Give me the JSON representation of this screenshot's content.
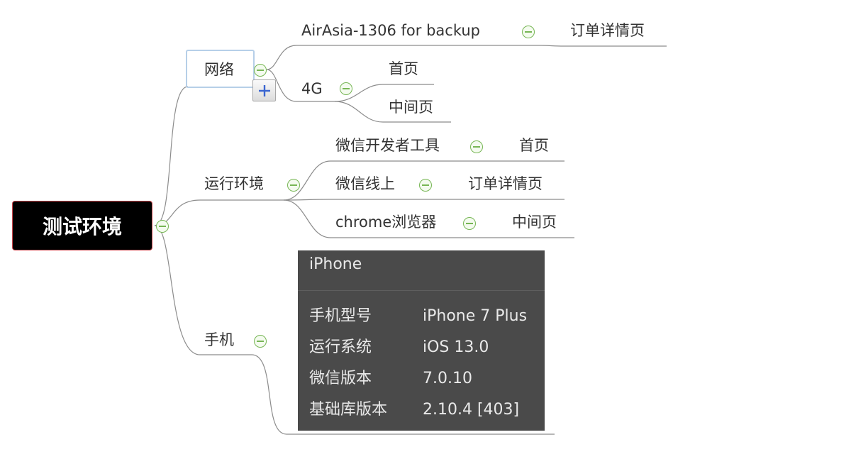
{
  "mindmap": {
    "root": {
      "label": "测试环境"
    },
    "branches": [
      {
        "label": "网络",
        "children": [
          {
            "label": "AirAsia-1306 for backup",
            "children": [
              {
                "label": "订单详情页"
              }
            ]
          },
          {
            "label": "4G",
            "children": [
              {
                "label": "首页"
              },
              {
                "label": "中间页"
              }
            ]
          }
        ]
      },
      {
        "label": "运行环境",
        "children": [
          {
            "label": "微信开发者工具",
            "children": [
              {
                "label": "首页"
              }
            ]
          },
          {
            "label": "微信线上",
            "children": [
              {
                "label": "订单详情页"
              }
            ]
          },
          {
            "label": "chrome浏览器",
            "children": [
              {
                "label": "中间页"
              }
            ]
          }
        ]
      },
      {
        "label": "手机",
        "note": {
          "title": "iPhone",
          "rows": [
            {
              "key": "手机型号",
              "value": "iPhone 7 Plus"
            },
            {
              "key": "运行系统",
              "value": "iOS 13.0"
            },
            {
              "key": "微信版本",
              "value": "7.0.10"
            },
            {
              "key": "基础库版本",
              "value": "2.10.4 [403]"
            }
          ]
        }
      }
    ]
  },
  "colors": {
    "root_fill": "#000000",
    "root_border": "#c8464b",
    "connector": "#8c8c8c",
    "toggle": "#77b655",
    "selection": "#b6cfe8",
    "note_fill": "#4a4a4a"
  },
  "icons": {
    "collapse": "minus-circle-icon",
    "add": "plus-icon"
  }
}
